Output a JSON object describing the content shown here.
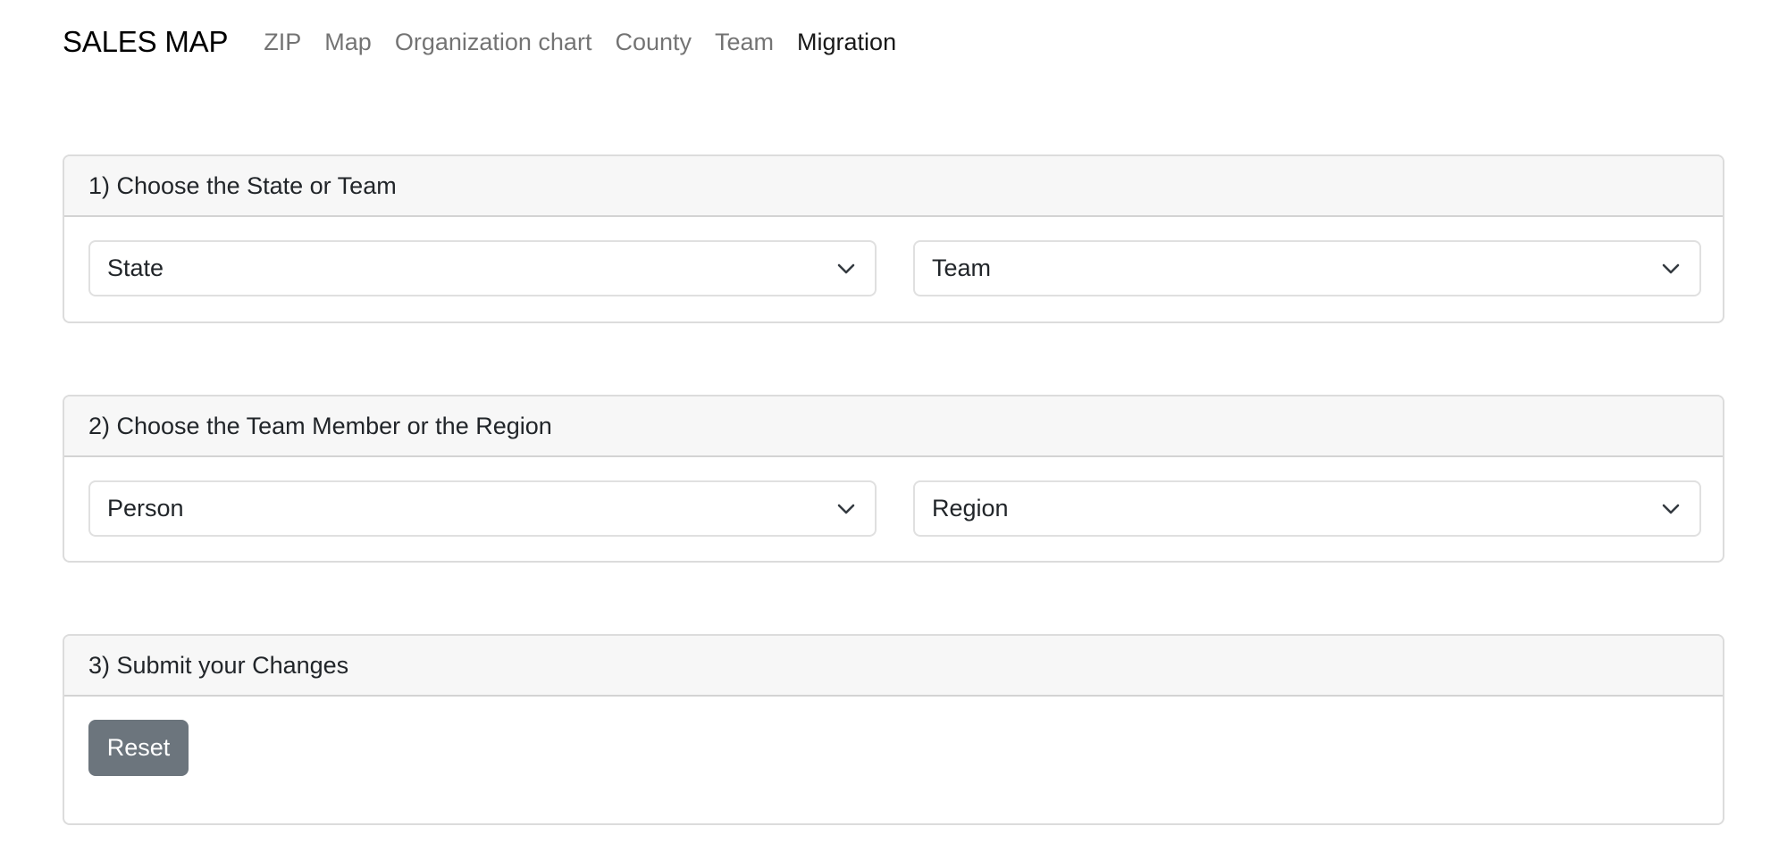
{
  "navbar": {
    "brand": "SALES MAP",
    "links": [
      {
        "label": "ZIP",
        "active": false
      },
      {
        "label": "Map",
        "active": false
      },
      {
        "label": "Organization chart",
        "active": false
      },
      {
        "label": "County",
        "active": false
      },
      {
        "label": "Team",
        "active": false
      },
      {
        "label": "Migration",
        "active": true
      }
    ]
  },
  "step1": {
    "title": "1) Choose the State or Team",
    "state_select": {
      "selected": "State",
      "icon": "chevron-down-icon"
    },
    "team_select": {
      "selected": "Team",
      "icon": "chevron-down-icon"
    }
  },
  "step2": {
    "title": "2) Choose the Team Member or the Region",
    "person_select": {
      "selected": "Person",
      "icon": "chevron-down-icon"
    },
    "region_select": {
      "selected": "Region",
      "icon": "chevron-down-icon"
    }
  },
  "step3": {
    "title": "3) Submit your Changes",
    "reset_label": "Reset"
  },
  "colors": {
    "reset_button": "#6c757d",
    "card_header_bg": "#f7f7f7",
    "border": "#dcdcdc"
  }
}
